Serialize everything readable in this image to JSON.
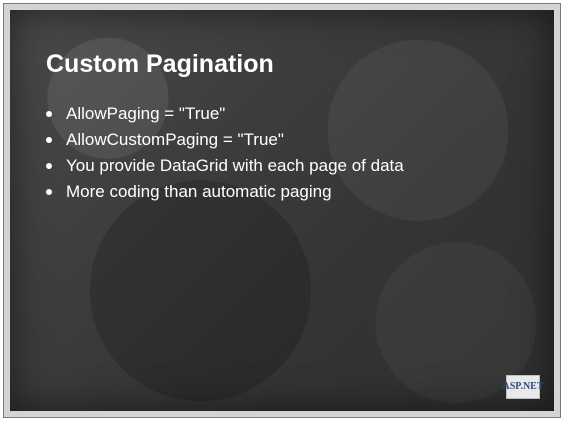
{
  "slide": {
    "title": "Custom Pagination",
    "bullets": [
      "AllowPaging = \"True\"",
      "AllowCustomPaging = \"True\"",
      "You provide DataGrid with each page of data",
      "More coding than automatic paging"
    ],
    "logo": {
      "top_text": "",
      "main_text": "ASP.NET",
      "bottom_text": ""
    }
  }
}
